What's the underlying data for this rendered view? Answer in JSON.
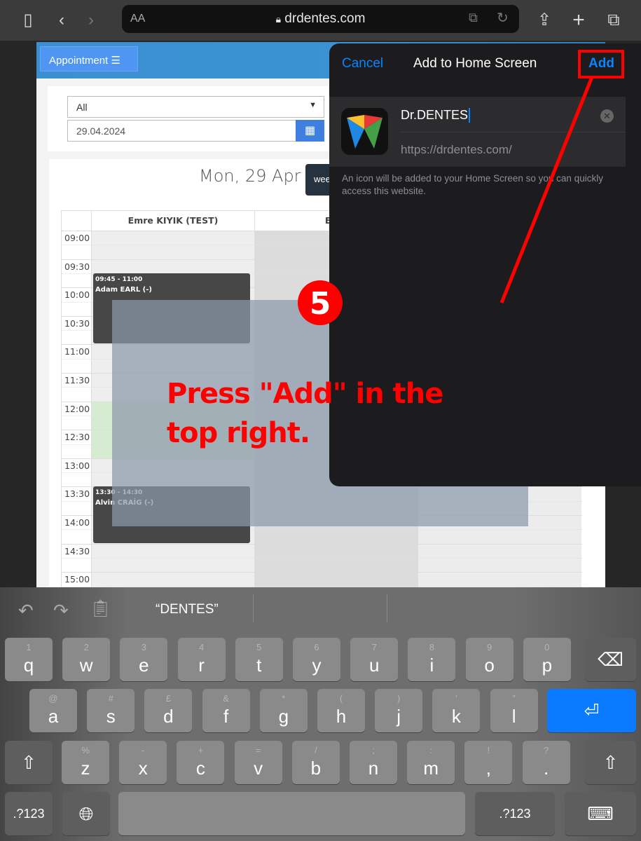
{
  "browser": {
    "url": "drdentes.com",
    "reader_label": "AA",
    "icons": [
      "sidebar-icon",
      "back-icon",
      "forward-icon",
      "lock-icon",
      "extension-icon",
      "reload-icon",
      "share-icon",
      "new-tab-icon",
      "tabs-icon"
    ]
  },
  "site": {
    "menu_button": "Appointment ☰",
    "filter_value": "All",
    "date_value": "29.04.2024",
    "date_title": "Mon, 29 Apr",
    "view_button": "wee",
    "columns": [
      "Emre KIYIK (TEST)",
      "Erde"
    ],
    "times": [
      "09:00",
      "09:30",
      "10:00",
      "10:30",
      "11:00",
      "11:30",
      "12:00",
      "12:30",
      "13:00",
      "13:30",
      "14:00",
      "14:30",
      "15:00"
    ],
    "events": [
      {
        "time": "09:45 - 11:00",
        "name": "Adam EARL (-)"
      },
      {
        "time": "13:30 - 14:30",
        "name": "Alvin CRAİG (-)"
      }
    ]
  },
  "dialog": {
    "cancel": "Cancel",
    "title": "Add to Home Screen",
    "add": "Add",
    "app_name": "Dr.DENTES",
    "app_url": "https://drdentes.com/",
    "info": "An icon will be added to your Home Screen so you can quickly access this website."
  },
  "tutorial": {
    "step": "5",
    "instruction": "Press \"Add\" in the top right.",
    "accent": "#ff0000"
  },
  "keyboard": {
    "suggestion": "“DENTES”",
    "row1": [
      [
        "1",
        "q"
      ],
      [
        "2",
        "w"
      ],
      [
        "3",
        "e"
      ],
      [
        "4",
        "r"
      ],
      [
        "5",
        "t"
      ],
      [
        "6",
        "y"
      ],
      [
        "7",
        "u"
      ],
      [
        "8",
        "i"
      ],
      [
        "9",
        "o"
      ],
      [
        "0",
        "p"
      ]
    ],
    "row2": [
      [
        "@",
        "a"
      ],
      [
        "#",
        "s"
      ],
      [
        "£",
        "d"
      ],
      [
        "&",
        "f"
      ],
      [
        "*",
        "g"
      ],
      [
        "(",
        "h"
      ],
      [
        ")",
        "j"
      ],
      [
        "’",
        "k"
      ],
      [
        "”",
        "l"
      ]
    ],
    "row3": [
      [
        "%",
        "z"
      ],
      [
        "-",
        "x"
      ],
      [
        "+",
        "c"
      ],
      [
        "=",
        "v"
      ],
      [
        "/",
        "b"
      ],
      [
        ";",
        "n"
      ],
      [
        ":",
        "m"
      ],
      [
        "!",
        ","
      ],
      [
        "?",
        "."
      ]
    ],
    "numbers_label": ".?123",
    "return_color": "#0a7aff"
  }
}
